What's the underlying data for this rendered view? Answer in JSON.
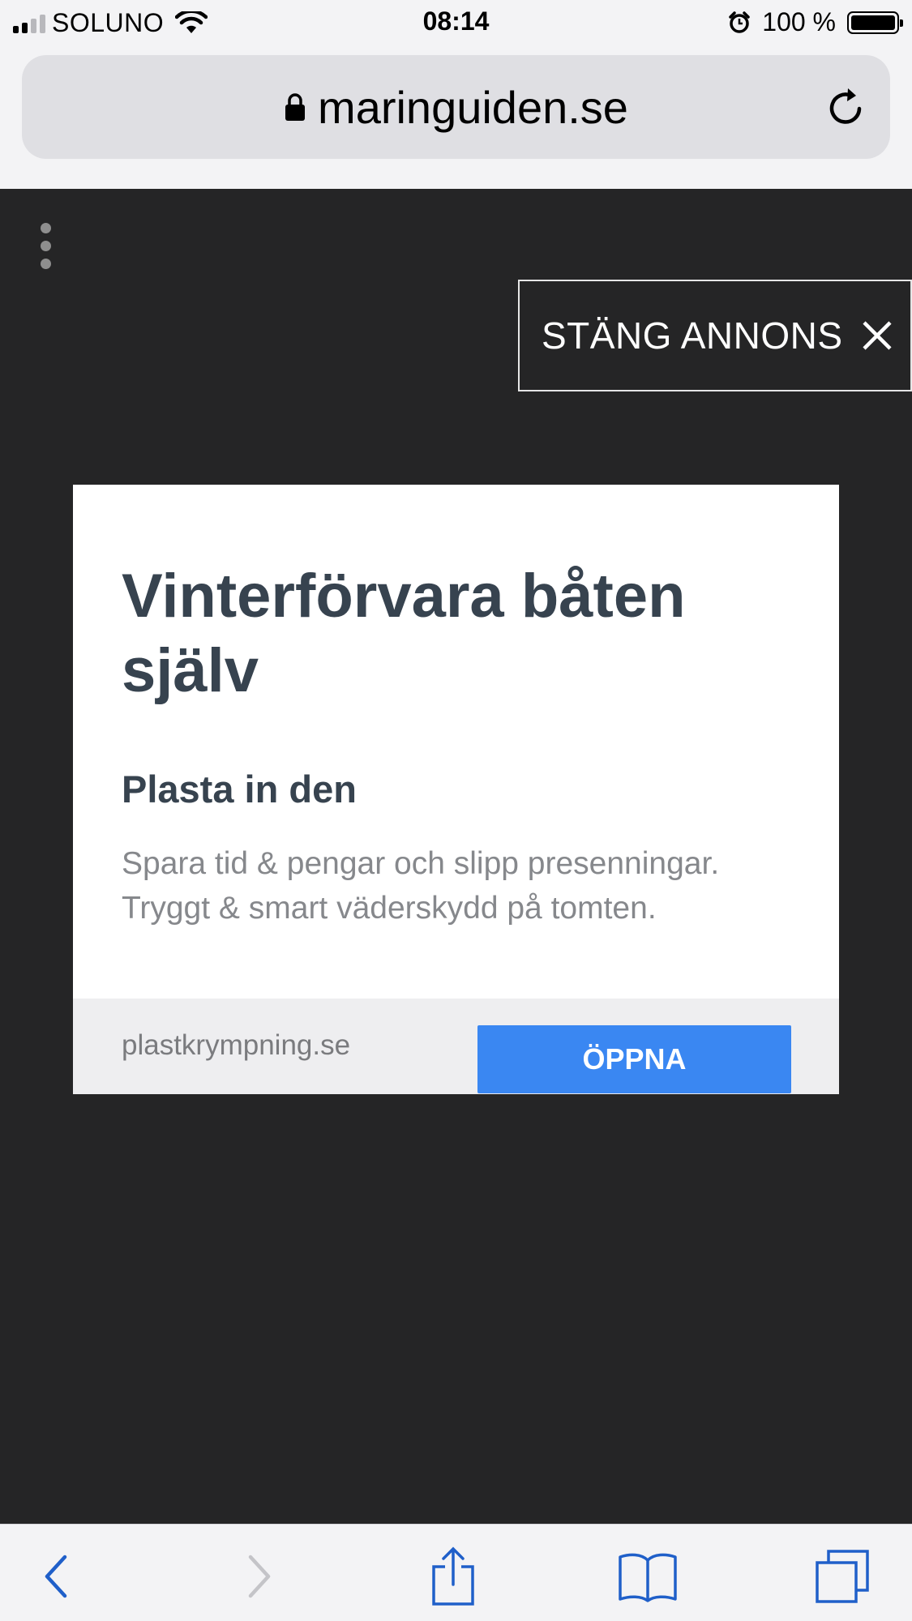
{
  "status_bar": {
    "carrier": "SOLUNO",
    "time": "08:14",
    "battery_percent": "100 %",
    "battery_level": 1.0,
    "signal_bars": 4,
    "signal_bars_active": 2
  },
  "address_bar": {
    "url": "maringuiden.se",
    "lock_icon": "lock-icon",
    "reload_icon": "reload-icon"
  },
  "page": {
    "menu_icon": "kebab-menu-icon",
    "close_ad_label": "STÄNG ANNONS",
    "ad": {
      "title": "Vinterförvara båten själv",
      "subtitle": "Plasta in den",
      "description": "Spara tid & pengar och slipp presenningar. Tryggt & smart väderskydd på tomten.",
      "domain": "plastkrympning.se",
      "cta_label": "ÖPPNA",
      "cta_color": "#3a87f2"
    }
  },
  "toolbar": {
    "items": [
      "back-icon",
      "forward-icon",
      "share-icon",
      "bookmarks-icon",
      "tabs-icon"
    ],
    "accent": "#1f5fc9",
    "disabled": "#c4c4c8"
  }
}
